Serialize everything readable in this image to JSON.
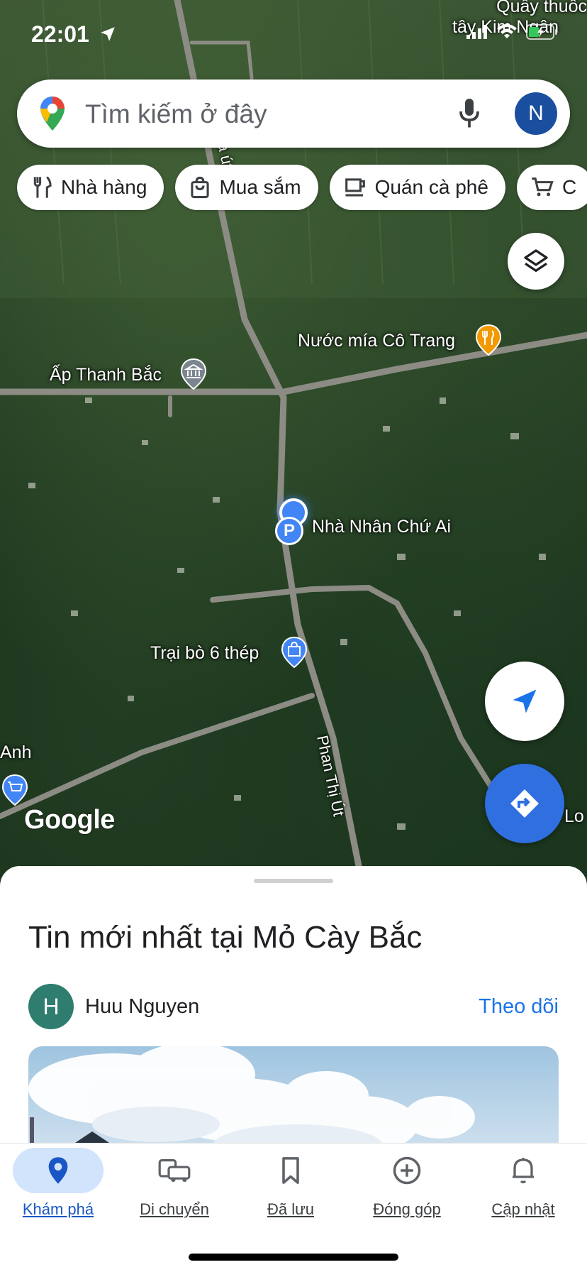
{
  "status_bar": {
    "time": "22:01"
  },
  "search": {
    "placeholder": "Tìm kiếm ở đây",
    "avatar_letter": "N"
  },
  "chips": [
    {
      "label": "Nhà hàng",
      "icon": "restaurant-icon"
    },
    {
      "label": "Mua sắm",
      "icon": "shopping-bag-icon"
    },
    {
      "label": "Quán cà phê",
      "icon": "coffee-icon"
    },
    {
      "label": "C",
      "icon": "cart-icon"
    }
  ],
  "map": {
    "labels": {
      "top_right_1": "Quầy thuốc",
      "top_right_2": "tây Kim Ngân",
      "road_north": "na út",
      "nuoc_mia": "Nước mía Cô Trang",
      "ap_thanh_bac": "Ấp Thanh Bắc",
      "nha_nhan": "Nhà Nhân Chứ Ai",
      "trai_bo": "Trại bò 6 thép",
      "anh": "Anh",
      "road_south": "Phan Thị Út",
      "lo": "Lo"
    },
    "attribution": "Google"
  },
  "sheet": {
    "title": "Tin mới nhất tại Mỏ Cày Bắc",
    "author_initial": "H",
    "author_name": "Huu Nguyen",
    "follow_label": "Theo dõi"
  },
  "nav": [
    {
      "label": "Khám phá",
      "icon": "explore-pin-icon",
      "active": true
    },
    {
      "label": "Di chuyển",
      "icon": "commute-icon",
      "active": false
    },
    {
      "label": "Đã lưu",
      "icon": "bookmark-icon",
      "active": false
    },
    {
      "label": "Đóng góp",
      "icon": "add-circle-icon",
      "active": false
    },
    {
      "label": "Cập nhật",
      "icon": "bell-icon",
      "active": false
    }
  ],
  "colors": {
    "accent": "#1a73e8",
    "directions": "#2f6fe0",
    "poi_orange": "#f29900",
    "poi_blue": "#4285f4"
  }
}
